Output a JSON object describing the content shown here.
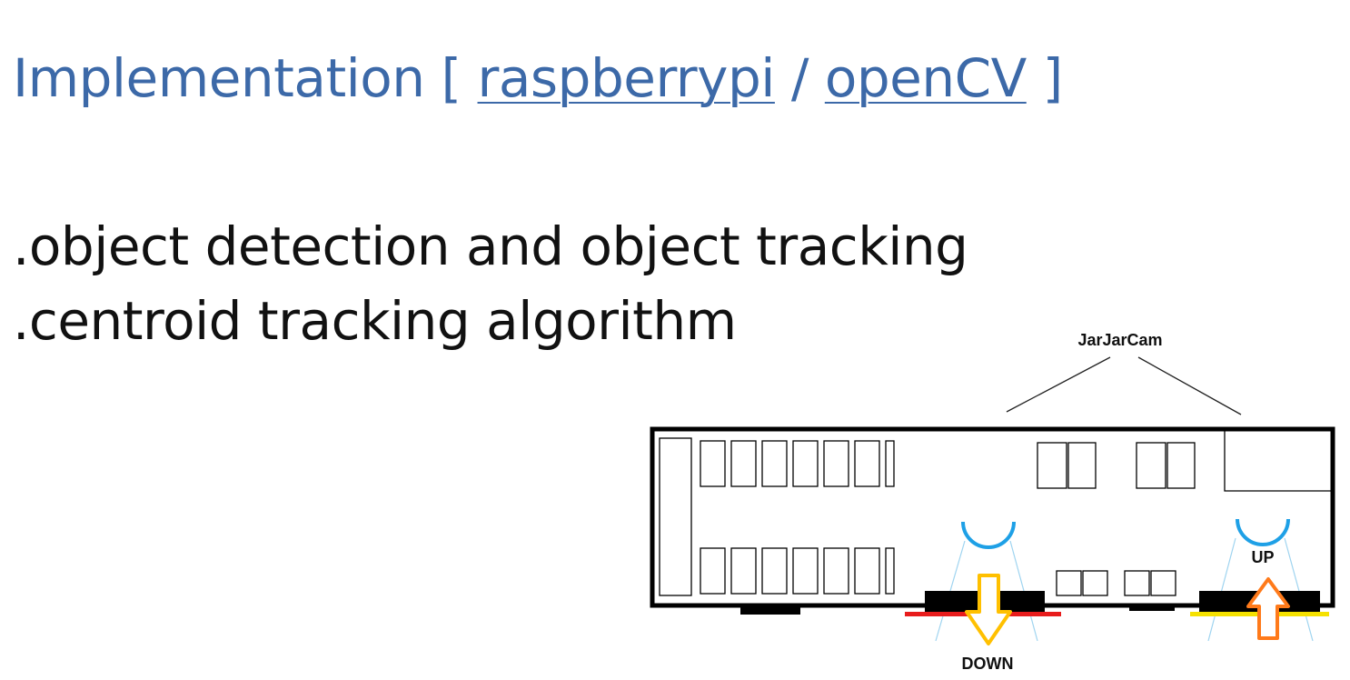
{
  "slide": {
    "title_prefix": "Implementation [ ",
    "link_raspberrypi": "raspberrypi",
    "separator": " / ",
    "link_opencv": "openCV",
    "title_suffix": " ]",
    "bullets": [
      ".object detection and object tracking",
      ".centroid tracking algorithm"
    ]
  },
  "diagram": {
    "camera_label": "JarJarCam",
    "up_label": "UP",
    "down_label": "DOWN",
    "colors": {
      "camera_arc": "#1ea0e6",
      "down_line": "#e81c1c",
      "up_line": "#f5e100",
      "down_arrow": "#ffc000",
      "up_arrow": "#ff7a1a",
      "fov_line": "#9fd4f0"
    }
  }
}
